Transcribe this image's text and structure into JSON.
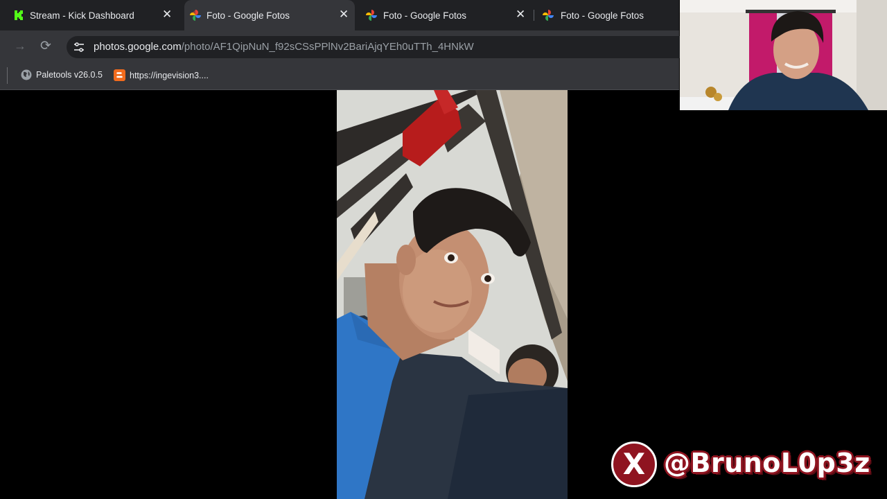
{
  "browser": {
    "tabs": [
      {
        "title": "Stream - Kick Dashboard",
        "close": "✕",
        "active": false,
        "favicon": "kick-icon"
      },
      {
        "title": "Foto - Google Fotos",
        "close": "✕",
        "active": true,
        "favicon": "google-photos-icon"
      },
      {
        "title": "Foto - Google Fotos",
        "close": "✕",
        "active": false,
        "favicon": "google-photos-icon"
      },
      {
        "title": "Foto - Google Fotos",
        "close": "",
        "active": false,
        "favicon": "google-photos-icon"
      }
    ],
    "toolbar": {
      "forward_icon": "→",
      "reload_icon": "⟳",
      "site_info_icon": "tune-icon",
      "url_host": "photos.google.com",
      "url_path": "/photo/AF1QipNuN_f92sCSsPPlNv2BariAjqYEh0uTTh_4HNkW"
    },
    "bookmarks": [
      {
        "label": "Paletools v26.0.5",
        "icon": "globe-icon"
      },
      {
        "label": "https://ingevision3....",
        "icon": "blogger-icon"
      }
    ]
  },
  "colors": {
    "chrome_dark": "#202124",
    "chrome_toolbar": "#35363a",
    "kick_green": "#53fc18",
    "brand_red": "#8f1420"
  },
  "overlay": {
    "social_icon": "x-logo-icon",
    "x_glyph": "X",
    "handle": "@BrunoL0p3z"
  }
}
